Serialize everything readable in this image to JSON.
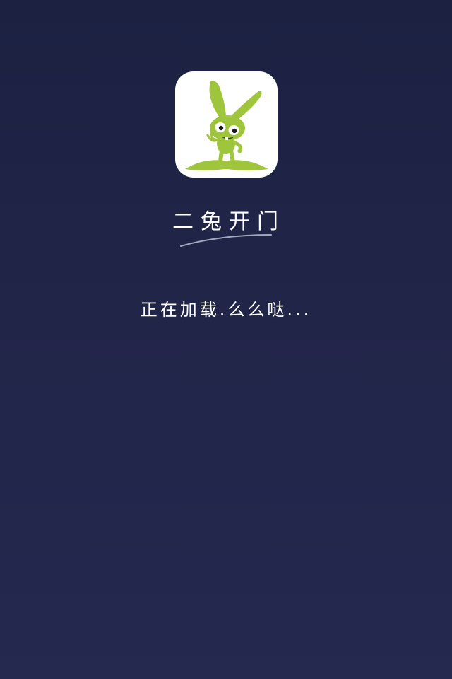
{
  "splash": {
    "app_name": "二兔开门",
    "loading_text": "正在加载.么么哒...",
    "logo_icon": "green-rabbit-logo",
    "colors": {
      "background_top": "#1c2142",
      "background_bottom": "#25284f",
      "logo_green": "#9fc53d",
      "text": "#ffffff"
    }
  }
}
